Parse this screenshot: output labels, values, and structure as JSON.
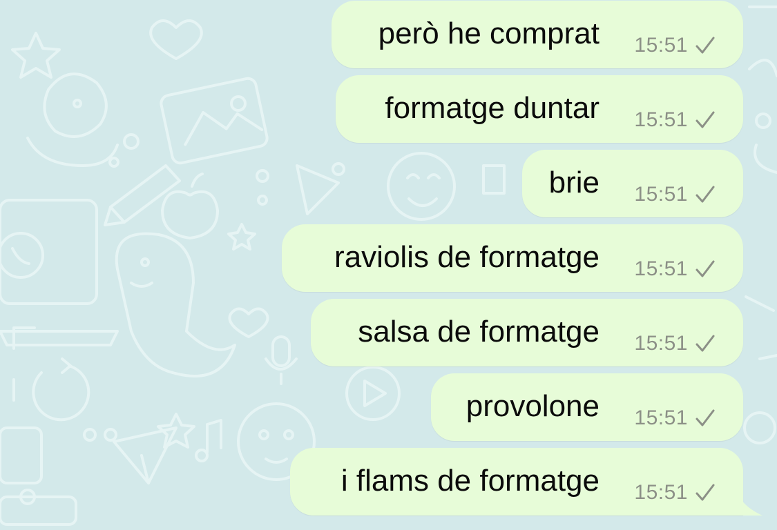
{
  "chat": {
    "colors": {
      "wallpaper": "#d3e9ea",
      "wallpaper_doodles": "#e6f4f4",
      "bubble": "#e7fcd8",
      "text": "#0b0b0b",
      "meta": "#8c9087"
    },
    "messages": [
      {
        "text": "però he comprat",
        "time": "15:51",
        "status": "sent-check-icon"
      },
      {
        "text": "formatge duntar",
        "time": "15:51",
        "status": "sent-check-icon"
      },
      {
        "text": "brie",
        "time": "15:51",
        "status": "sent-check-icon"
      },
      {
        "text": "raviolis de formatge",
        "time": "15:51",
        "status": "sent-check-icon"
      },
      {
        "text": "salsa de formatge",
        "time": "15:51",
        "status": "sent-check-icon"
      },
      {
        "text": "provolone",
        "time": "15:51",
        "status": "sent-check-icon"
      },
      {
        "text": "i flams de formatge",
        "time": "15:51",
        "status": "sent-check-icon"
      }
    ]
  }
}
